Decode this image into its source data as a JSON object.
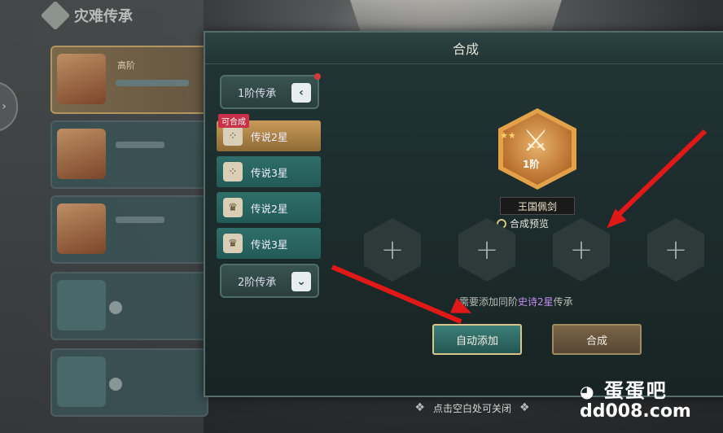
{
  "left_panel": {
    "header": "灾难传承",
    "characters": [
      {
        "name": "高阶",
        "state": "active"
      },
      {
        "name": "",
        "state": "normal"
      },
      {
        "name": "",
        "state": "normal"
      },
      {
        "name": "",
        "state": "locked"
      },
      {
        "name": "",
        "state": "locked"
      }
    ]
  },
  "dialog": {
    "title": "合成",
    "tabs": {
      "tier1": "1阶传承",
      "tier2": "2阶传承",
      "tier1_chevron": "‹",
      "tier2_chevron": "⌄",
      "items": [
        {
          "label": "传说2星",
          "badge": "可合成",
          "emblem": "⁘",
          "selected": true
        },
        {
          "label": "传说3星",
          "badge": "",
          "emblem": "⁘",
          "selected": false
        },
        {
          "label": "传说2星",
          "badge": "",
          "emblem": "♛",
          "selected": false
        },
        {
          "label": "传说3星",
          "badge": "",
          "emblem": "♛",
          "selected": false
        }
      ]
    },
    "item": {
      "tier": "1阶",
      "name": "王国佩剑",
      "stars": "★★",
      "preview_label": "合成预览"
    },
    "slots": [
      "+",
      "+",
      "+",
      "+"
    ],
    "hint": {
      "prefix": "需要添加同阶",
      "highlight": "史诗2星",
      "suffix": "传承"
    },
    "buttons": {
      "auto_add": "自动添加",
      "merge": "合成"
    }
  },
  "footer": {
    "close_hint": "点击空白处可关闭"
  },
  "watermark": {
    "logo": "蛋蛋吧",
    "url": "dd008.com"
  },
  "colors": {
    "annotation_arrow": "#e01818",
    "hint_highlight": "#c38dee",
    "selected_tab": "#c89a58"
  }
}
